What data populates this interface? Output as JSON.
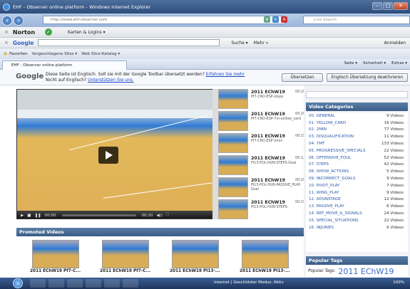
{
  "window": {
    "title": "EHF - Observer online platform - Windows Internet Explorer"
  },
  "address": {
    "url": "http://www.ehf-observer.com",
    "search_placeholder": "Live Search"
  },
  "norton": {
    "logo": "Norton",
    "ok": "✓",
    "menu": "Karten & Logins ▾"
  },
  "google_toolbar": {
    "logo": "Google",
    "search": "Suche ▾",
    "more": "Mehr »",
    "signin": "Anmelden"
  },
  "favorites": {
    "label": "Favoriten",
    "items": [
      "Vorgeschlagene Sites ▾",
      "Web Slice-Katalog ▾"
    ]
  },
  "tab": {
    "title": "EHF - Observer online platform"
  },
  "commands": [
    "Seite ▾",
    "Sicherheit ▾",
    "Extras ▾"
  ],
  "translate": {
    "logo": "Google",
    "message": "Diese Seite ist Englisch. Soll sie mit der Google Toolbar übersetzt werden?",
    "more_link": "Erfahren Sie mehr",
    "not_english": "Nicht auf Englisch?",
    "help_link": "Unterstützen Sie uns.",
    "translate_button": "Übersetzen",
    "disable_button": "Englisch Übersetzung deaktivieren"
  },
  "player": {
    "time_current": "00:00",
    "time_total": "00:20",
    "volume": "◀))"
  },
  "video_list": [
    {
      "title": "2011 EChW19",
      "time": "00:20",
      "sub": "Pf7-CRO-ESP-steps"
    },
    {
      "title": "2011 EChW19",
      "time": "00:20",
      "sub": "Pf7-CRO-ESP-7m-yellow_card"
    },
    {
      "title": "2011 EChW19",
      "time": "00:15",
      "sub": "Pf7-CRO-ESP-2min"
    },
    {
      "title": "2011 EChW19",
      "time": "00:12",
      "sub": "PI13-POL-HUN-STEPS-Goal"
    },
    {
      "title": "2011 EChW19",
      "time": "00:20",
      "sub": "PI13-POL-HUN-PASSIVE_PLAY-Goal"
    },
    {
      "title": "2011 EChW19",
      "time": "00:15",
      "sub": "PI13-POL-HUN-STEPS-"
    }
  ],
  "promoted": {
    "heading": "Promoted Videos",
    "items": [
      {
        "title": "2011 EChW19 Pf7-C..."
      },
      {
        "title": "2011 EChW19 Pf7-C..."
      },
      {
        "title": "2011 EChW19 PI13-..."
      },
      {
        "title": "2011 EChW19 PI13-..."
      }
    ]
  },
  "categories": {
    "heading": "Video Categories",
    "items": [
      {
        "name": "00. GENERAL",
        "count": "9 Videos"
      },
      {
        "name": "01. YELLOW_CARD",
        "count": "16 Videos"
      },
      {
        "name": "02. 2MIN",
        "count": "77 Videos"
      },
      {
        "name": "03. DISQUALIFICATION",
        "count": "11 Videos"
      },
      {
        "name": "04. 7MT",
        "count": "133 Videos"
      },
      {
        "name": "05. PROGRESSIVE_SPECIALS",
        "count": "22 Videos"
      },
      {
        "name": "06. OFFENSIVE_FOUL",
        "count": "52 Videos"
      },
      {
        "name": "07. STEPS",
        "count": "42 Videos"
      },
      {
        "name": "08. SHOW_ACTIONS",
        "count": "5 Videos"
      },
      {
        "name": "09. INCORRECT_GOALS",
        "count": "9 Videos"
      },
      {
        "name": "10. PIVOT_PLAY",
        "count": "7 Videos"
      },
      {
        "name": "11. WING_PLAY",
        "count": "9 Videos"
      },
      {
        "name": "12. ADVANTAGE",
        "count": "12 Videos"
      },
      {
        "name": "13. PASSIVE_PLAY",
        "count": "6 Videos"
      },
      {
        "name": "14. REF_MOVE_&_SIGNALS",
        "count": "24 Videos"
      },
      {
        "name": "15. SPECIAL_SITUATIONS",
        "count": "22 Videos"
      },
      {
        "name": "16. INJURIES",
        "count": "6 Videos"
      }
    ]
  },
  "tags": {
    "heading": "Popular Tags",
    "label": "Popular Tags:",
    "value": "2011 EChW19"
  },
  "status": {
    "text": "Internet | Geschützter Modus: Aktiv",
    "zoom": "100%"
  },
  "colors": {
    "header_blue": "#3a5d86",
    "link_blue": "#2a5aa8",
    "court_orange": "#e0b058"
  }
}
